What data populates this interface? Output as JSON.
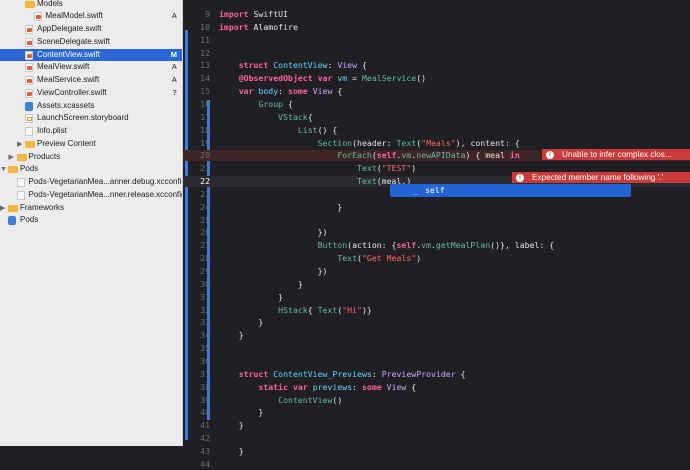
{
  "navigator": {
    "items": [
      {
        "label": "Models",
        "type": "folder",
        "indent": 2,
        "status": ""
      },
      {
        "label": "MealModel.swift",
        "type": "swift",
        "indent": 3,
        "status": "A"
      },
      {
        "label": "AppDelegate.swift",
        "type": "swift",
        "indent": 2,
        "status": ""
      },
      {
        "label": "SceneDelegate.swift",
        "type": "swift",
        "indent": 2,
        "status": ""
      },
      {
        "label": "ContentView.swift",
        "type": "swift",
        "indent": 2,
        "status": "M",
        "selected": true
      },
      {
        "label": "MealView.swift",
        "type": "swift",
        "indent": 2,
        "status": "A"
      },
      {
        "label": "MealService.swift",
        "type": "swift",
        "indent": 2,
        "status": "A"
      },
      {
        "label": "ViewController.swift",
        "type": "swift",
        "indent": 2,
        "status": "?"
      },
      {
        "label": "Assets.xcassets",
        "type": "assets",
        "indent": 2,
        "status": ""
      },
      {
        "label": "LaunchScreen.storyboard",
        "type": "storyboard",
        "indent": 2,
        "status": ""
      },
      {
        "label": "Info.plist",
        "type": "plain",
        "indent": 2,
        "status": ""
      },
      {
        "label": "Preview Content",
        "type": "folder",
        "indent": 2,
        "status": "",
        "disclosure": "▶"
      },
      {
        "label": "Products",
        "type": "folder",
        "indent": 1,
        "status": "",
        "disclosure": "▶"
      },
      {
        "label": "Pods",
        "type": "folder",
        "indent": 0,
        "status": "",
        "disclosure": "▼"
      },
      {
        "label": "Pods-VegetarianMea...anner.debug.xcconfig",
        "type": "plain",
        "indent": 1,
        "status": ""
      },
      {
        "label": "Pods-VegetarianMea...nner.release.xcconfig",
        "type": "plain",
        "indent": 1,
        "status": ""
      },
      {
        "label": "Frameworks",
        "type": "folder",
        "indent": 0,
        "status": "",
        "disclosure": "▶"
      },
      {
        "label": "Pods",
        "type": "project",
        "indent": 0,
        "status": ""
      }
    ]
  },
  "editor": {
    "lines": [
      {
        "n": "9",
        "code": "<span class=\"k\">import</span> SwiftUI"
      },
      {
        "n": "10",
        "code": "<span class=\"k\">import</span> Alamofire"
      },
      {
        "n": "11",
        "code": ""
      },
      {
        "n": "12",
        "code": ""
      },
      {
        "n": "13",
        "code": "    <span class=\"k\">struct</span> <span class=\"t\">ContentView</span>: <span class=\"p\">View</span> {"
      },
      {
        "n": "14",
        "code": "    <span class=\"k\">@ObservedObject</span> <span class=\"k\">var</span> <span class=\"t\">vm</span> = <span class=\"f\">MealService</span>()"
      },
      {
        "n": "15",
        "code": "    <span class=\"k\">var</span> <span class=\"t\">body</span>: <span class=\"k\">some</span> <span class=\"p\">View</span> {"
      },
      {
        "n": "16",
        "code": "        <span class=\"f\">Group</span> {"
      },
      {
        "n": "17",
        "code": "            <span class=\"f\">VStack</span>{"
      },
      {
        "n": "18",
        "code": "                <span class=\"f\">List</span>() {"
      },
      {
        "n": "19",
        "code": "                    <span class=\"f\">Section</span>(header: <span class=\"f\">Text</span>(<span class=\"s\">\"Meals\"</span>), content: {"
      },
      {
        "n": "20",
        "code": "                        <span class=\"f\">ForEach</span>(<span class=\"k\">self</span>.<span class=\"f\">vm</span>.<span class=\"f\">newAPIData</span>) { meal <span class=\"k\">in</span>",
        "state": "err"
      },
      {
        "n": "21",
        "code": "                            <span class=\"f\">Text</span>(<span class=\"s\">\"TEST\"</span>)"
      },
      {
        "n": "22",
        "code": "                            <span class=\"f\">Text</span>(meal.)",
        "state": "cur"
      },
      {
        "n": "23",
        "code": ""
      },
      {
        "n": "24",
        "code": "                        }"
      },
      {
        "n": "25",
        "code": ""
      },
      {
        "n": "26",
        "code": "                    })"
      },
      {
        "n": "27",
        "code": "                    <span class=\"f\">Button</span>(action: {<span class=\"k\">self</span>.<span class=\"f\">vm</span>.<span class=\"f\">getMealPlan</span>()}, label: {"
      },
      {
        "n": "28",
        "code": "                        <span class=\"f\">Text</span>(<span class=\"s\">\"Get Meals\"</span>)"
      },
      {
        "n": "29",
        "code": "                    })"
      },
      {
        "n": "30",
        "code": "                }"
      },
      {
        "n": "31",
        "code": "            }"
      },
      {
        "n": "32",
        "code": "            <span class=\"f\">HStack</span>{ <span class=\"f\">Text</span>(<span class=\"s\">\"Hi\"</span>)}"
      },
      {
        "n": "33",
        "code": "        }"
      },
      {
        "n": "34",
        "code": "    }"
      },
      {
        "n": "35",
        "code": ""
      },
      {
        "n": "36",
        "code": ""
      },
      {
        "n": "37",
        "code": "    <span class=\"k\">struct</span> <span class=\"t\">ContentView_Previews</span>: <span class=\"p\">PreviewProvider</span> {"
      },
      {
        "n": "38",
        "code": "        <span class=\"k\">static</span> <span class=\"k\">var</span> <span class=\"t\">previews</span>: <span class=\"k\">some</span> <span class=\"p\">View</span> {"
      },
      {
        "n": "39",
        "code": "            <span class=\"f\">ContentView</span>()"
      },
      {
        "n": "40",
        "code": "        }"
      },
      {
        "n": "41",
        "code": "    }"
      },
      {
        "n": "42",
        "code": ""
      },
      {
        "n": "43",
        "code": "    }"
      },
      {
        "n": "44",
        "code": ""
      }
    ],
    "errors": [
      {
        "line": "20",
        "icon": "!",
        "text": "Unable to infer complex clos..."
      },
      {
        "line": "22",
        "icon": "!",
        "text": "Expected member name following '.'"
      }
    ],
    "autocomplete": {
      "type": "_",
      "text": "self"
    }
  },
  "colors": {
    "keyword": "#fc5fa3",
    "type": "#5dd8ff",
    "string": "#fc6a5d",
    "selection": "#2a67d4",
    "error": "#c93a3a"
  }
}
